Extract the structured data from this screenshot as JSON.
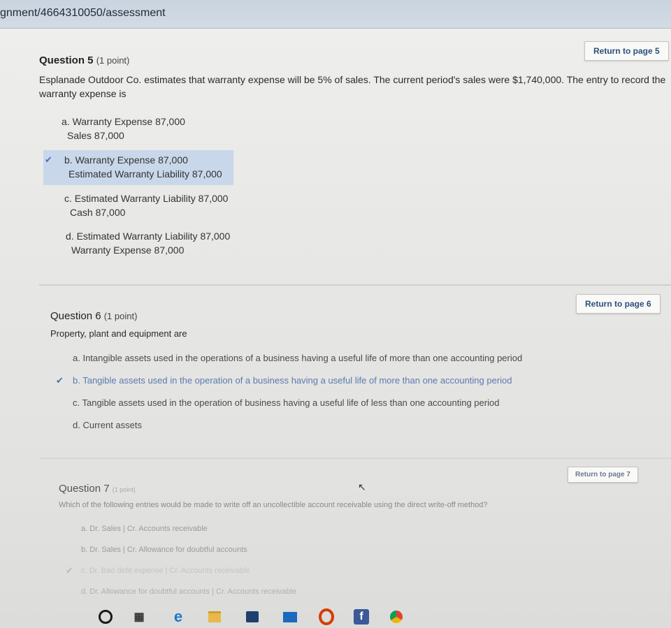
{
  "browser": {
    "url": "gnment/4664310050/assessment"
  },
  "q5": {
    "title": "Question 5",
    "points": "(1 point)",
    "text": "Esplanade Outdoor Co. estimates that warranty expense will be 5% of sales. The current period's sales were $1,740,000. The entry to record the warranty expense is",
    "return_label": "Return to page 5",
    "options": [
      {
        "line1": "a. Warranty Expense 87,000",
        "line2": "Sales  87,000"
      },
      {
        "line1": "b. Warranty Expense 87,000",
        "line2": "Estimated Warranty Liability  87,000"
      },
      {
        "line1": "c. Estimated Warranty Liability 87,000",
        "line2": "Cash  87,000"
      },
      {
        "line1": "d. Estimated Warranty Liability 87,000",
        "line2": "Warranty Expense  87,000"
      }
    ],
    "selected_index": 1
  },
  "q6": {
    "title": "Question 6",
    "points": "(1 point)",
    "text": "Property, plant and equipment are",
    "return_label": "Return to page 6",
    "options": [
      "a. Intangible assets used in the operations of a business having a useful life of more than one accounting period",
      "b. Tangible assets used in the operation of a business having a useful life of more than one accounting period",
      "c. Tangible assets used in the operation of business having a useful life of less than one accounting period",
      "d. Current assets"
    ],
    "selected_index": 1
  },
  "q7": {
    "title": "Question 7",
    "points": "(1 point)",
    "text": "Which of the following entries would be made to write off an uncollectible account receivable using the direct write-off method?",
    "return_label": "Return to page 7",
    "options": [
      "a. Dr. Sales | Cr. Accounts receivable",
      "b. Dr. Sales | Cr. Allowance for doubtful accounts",
      "c. Dr. Bad debt expense | Cr. Accounts receivable",
      "d. Dr. Allowance for doubtful accounts | Cr. Accounts receivable"
    ],
    "selected_index": 2
  },
  "taskbar": {
    "icons": [
      "search-circle-icon",
      "task-view-icon",
      "edge-icon",
      "file-explorer-icon",
      "store-icon",
      "mail-icon",
      "office-icon",
      "facebook-icon",
      "chrome-icon"
    ]
  }
}
